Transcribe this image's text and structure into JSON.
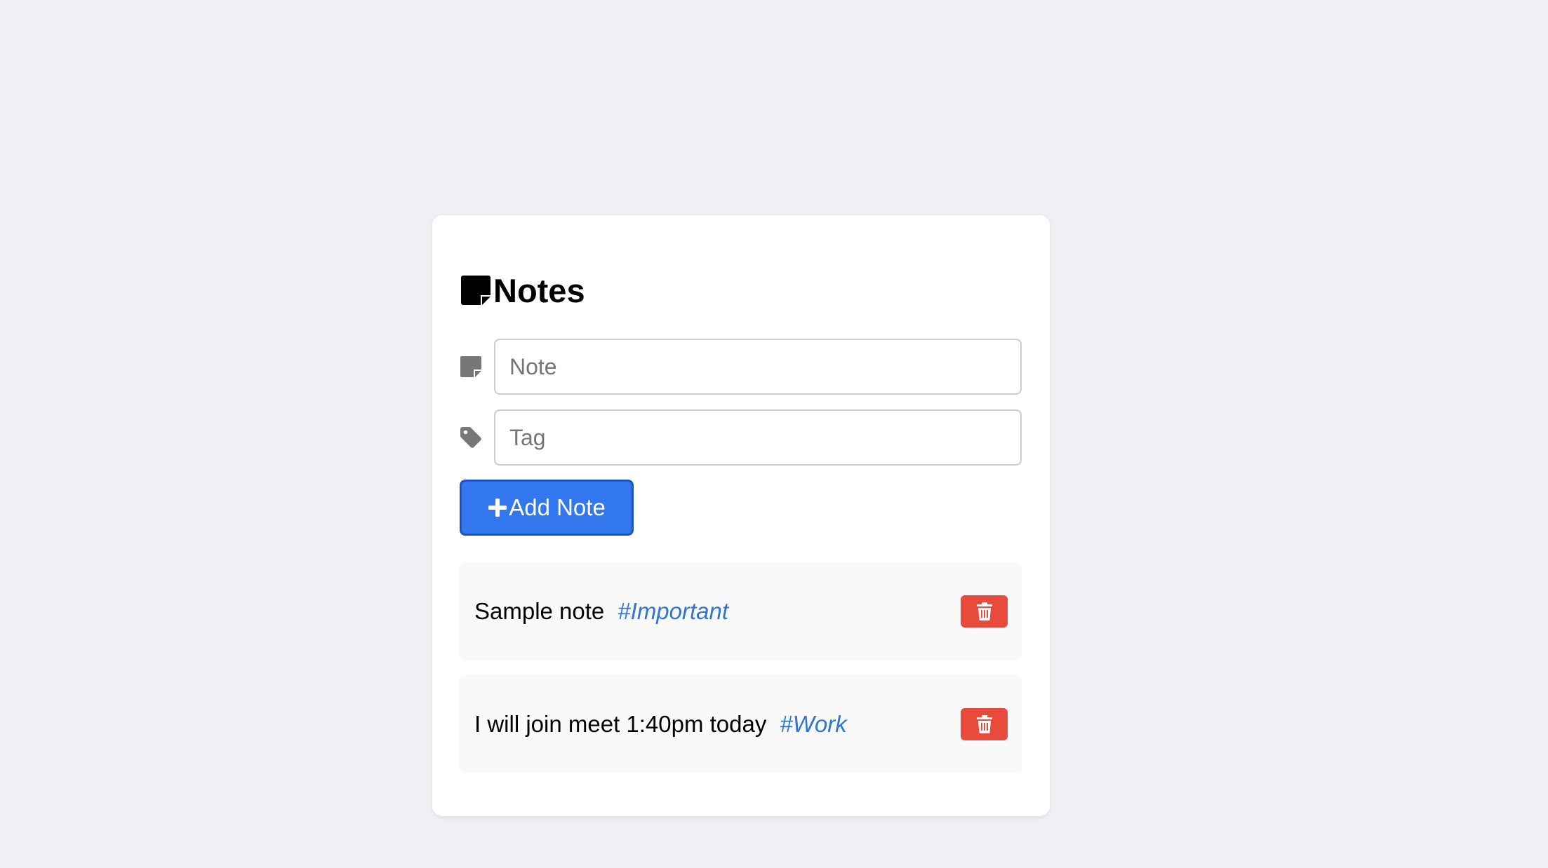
{
  "app": {
    "title": "Notes"
  },
  "form": {
    "note_placeholder": "Note",
    "note_value": "",
    "tag_placeholder": "Tag",
    "tag_value": "",
    "add_label": "Add Note"
  },
  "notes": [
    {
      "text": "Sample note",
      "tag": "#Important"
    },
    {
      "text": "I will join meet 1:40pm today",
      "tag": "#Work"
    }
  ],
  "icons": {
    "title": "sticky-note-icon",
    "note_field": "sticky-note-icon",
    "tag_field": "tag-icon",
    "add": "plus-icon",
    "delete": "trash-icon"
  },
  "colors": {
    "accent": "#3377ee",
    "tag": "#2f74d6",
    "danger": "#e84a3c",
    "background": "#f0f0f4"
  }
}
